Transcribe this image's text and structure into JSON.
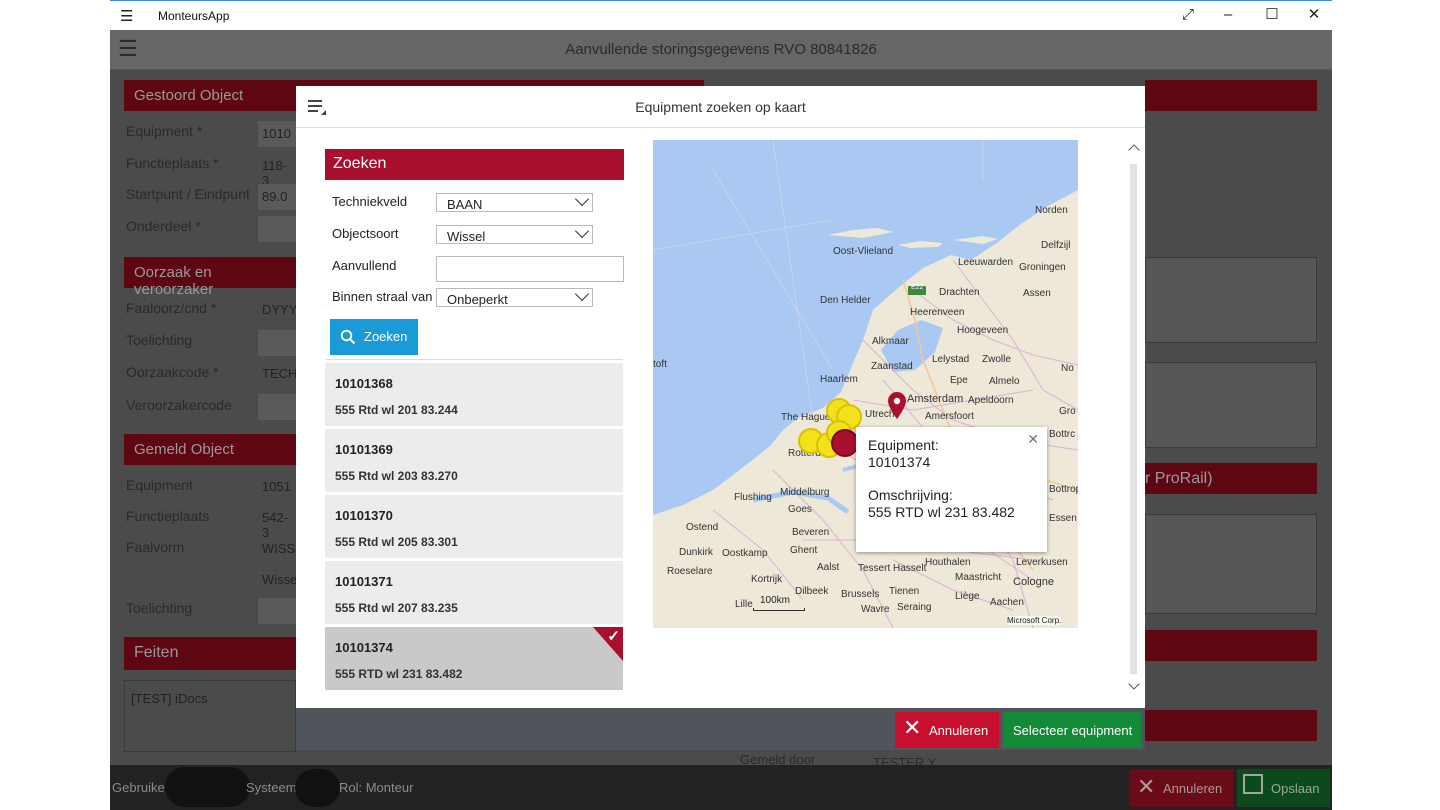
{
  "window": {
    "app_title": "MonteursApp"
  },
  "app": {
    "header_title": "Aanvullende storingsgegevens RVO 80841826"
  },
  "background": {
    "gestoord_object": {
      "title": "Gestoord Object",
      "fields": [
        {
          "label": "Equipment *",
          "value": "1010"
        },
        {
          "label": "Functieplaats *",
          "value": "118-3"
        },
        {
          "label": "Startpunt / Eindpunt",
          "value": "89.0"
        },
        {
          "label": "Onderdeel *",
          "value": ""
        }
      ]
    },
    "oorzaak": {
      "title": "Oorzaak en veroorzaker",
      "fields": [
        {
          "label": "Faaloorz/cnd *",
          "value": "DYYY"
        },
        {
          "label": "Toelichting",
          "value": ""
        },
        {
          "label": "Oorzaakcode *",
          "value": "TECH"
        },
        {
          "label": "Veroorzakercode",
          "value": ""
        }
      ]
    },
    "gemeld_object": {
      "title": "Gemeld Object",
      "fields": [
        {
          "label": "Equipment",
          "value": "1051"
        },
        {
          "label": "Functieplaats",
          "value": "542-3"
        },
        {
          "label": "Faalvorm",
          "value": "WISS"
        },
        {
          "label": "",
          "value": "Wisse"
        },
        {
          "label": "Toelichting",
          "value": ""
        }
      ]
    },
    "feiten": {
      "title": "Feiten",
      "text": "[TEST] iDocs"
    },
    "right_partial_text": "r ProRail)",
    "gemeld_door_label": "Gemeld door",
    "gemeld_door_value": "TESTER Y"
  },
  "dialog": {
    "title": "Equipment zoeken op kaart",
    "search_section_title": "Zoeken",
    "form": {
      "techniekveld": {
        "label": "Techniekveld",
        "value": "BAAN"
      },
      "objectsoort": {
        "label": "Objectsoort",
        "value": "Wissel"
      },
      "aanvullend": {
        "label": "Aanvullend",
        "value": ""
      },
      "straal": {
        "label": "Binnen straal van",
        "value": "Onbeperkt"
      }
    },
    "search_button": "Zoeken",
    "results": [
      {
        "number": "10101368",
        "description": "555 Rtd wl 201 83.244",
        "selected": false
      },
      {
        "number": "10101369",
        "description": "555 Rtd wl 203 83.270",
        "selected": false
      },
      {
        "number": "10101370",
        "description": "555 Rtd wl 205 83.301",
        "selected": false
      },
      {
        "number": "10101371",
        "description": "555 Rtd wl 207 83.235",
        "selected": false
      },
      {
        "number": "10101374",
        "description": "555 RTD wl 231 83.482",
        "selected": true
      }
    ],
    "map": {
      "labels": [
        "Norden",
        "Delfzijl",
        "Oost-Vlieland",
        "Leeuwarden",
        "Groningen",
        "Den Helder",
        "Drachten",
        "Assen",
        "Heerenveen",
        "Hoogeveen",
        "Alkmaar",
        "Lelystad",
        "Zwolle",
        "Zaanstad",
        "Haarlem",
        "Epe",
        "Almelo",
        "Amsterdam",
        "Apeldoorn",
        "The Hague",
        "Utrecht",
        "Amersfoort",
        "Rotterdam",
        "Middelburg",
        "Flushing",
        "Goes",
        "Ostend",
        "Oostkamp",
        "Ghent",
        "Dunkirk",
        "Roeselare",
        "Kortrijk",
        "Aalst",
        "Dilbeek",
        "Brussels",
        "Tienen",
        "Wavre",
        "Seraing",
        "Lille",
        "Tessert",
        "Hasselt",
        "Maastricht",
        "Cologne",
        "Leverkusen",
        "Aachen",
        "Bottrop",
        "Essen",
        "Houthalen",
        "Liège",
        "Beveren",
        "toft",
        "Gro",
        "No",
        "Bottrc"
      ],
      "scale": "100km",
      "copyright": "Microsoft Corp.",
      "road_badge": "E22",
      "popup": {
        "equipment_label": "Equipment:",
        "equipment_value": "10101374",
        "omschrijving_label": "Omschrijving:",
        "omschrijving_value": "555 RTD wl 231 83.482"
      }
    },
    "cancel_button": "Annuleren",
    "select_button": "Selecteer equipment"
  },
  "statusbar": {
    "gebruiker_label": "Gebruiker",
    "systeem_label": "Systeem",
    "rol": "Rol: Monteur",
    "cancel_button": "Annuleren",
    "save_button": "Opslaan"
  },
  "colors": {
    "brand_red": "#a8102e",
    "search_blue": "#1a9bd8",
    "select_green": "#138a36",
    "cancel_red": "#c8102e"
  }
}
